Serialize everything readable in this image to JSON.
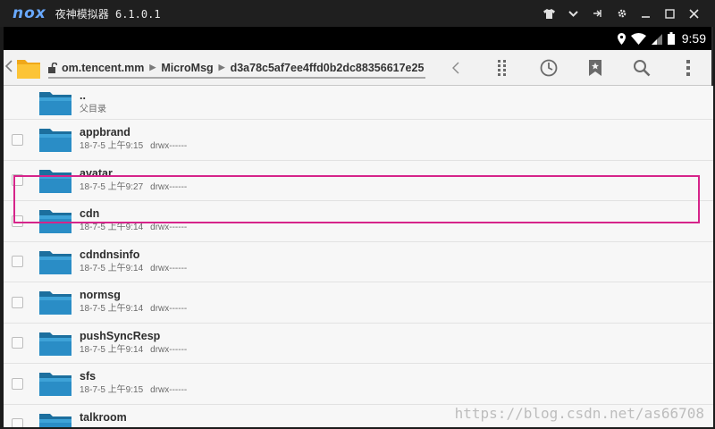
{
  "window": {
    "logo": "nox",
    "title": "夜神模拟器 6.1.0.1",
    "controls": [
      "shirt-icon",
      "chevron-down-icon",
      "pin-icon",
      "gear-icon",
      "minimize-icon",
      "maximize-icon",
      "close-icon"
    ]
  },
  "statusbar": {
    "time": "9:59"
  },
  "toolbar": {
    "path": [
      "om.tencent.mm",
      "MicroMsg",
      "d3a78c5af7ee4ffd0b2dc88356617e25"
    ]
  },
  "parent": {
    "name": "..",
    "label": "父目录"
  },
  "files": [
    {
      "name": "appbrand",
      "date": "18-7-5 上午9:15",
      "perm": "drwx------"
    },
    {
      "name": "avatar",
      "date": "18-7-5 上午9:27",
      "perm": "drwx------"
    },
    {
      "name": "cdn",
      "date": "18-7-5 上午9:14",
      "perm": "drwx------"
    },
    {
      "name": "cdndnsinfo",
      "date": "18-7-5 上午9:14",
      "perm": "drwx------"
    },
    {
      "name": "normsg",
      "date": "18-7-5 上午9:14",
      "perm": "drwx------"
    },
    {
      "name": "pushSyncResp",
      "date": "18-7-5 上午9:14",
      "perm": "drwx------"
    },
    {
      "name": "sfs",
      "date": "18-7-5 上午9:15",
      "perm": "drwx------"
    },
    {
      "name": "talkroom",
      "date": "",
      "perm": ""
    }
  ],
  "watermark": "https://blog.csdn.net/as66708",
  "colors": {
    "highlight": "#d6248a",
    "folder": "#2a8dc6",
    "nox_logo": "#69a9ff"
  }
}
